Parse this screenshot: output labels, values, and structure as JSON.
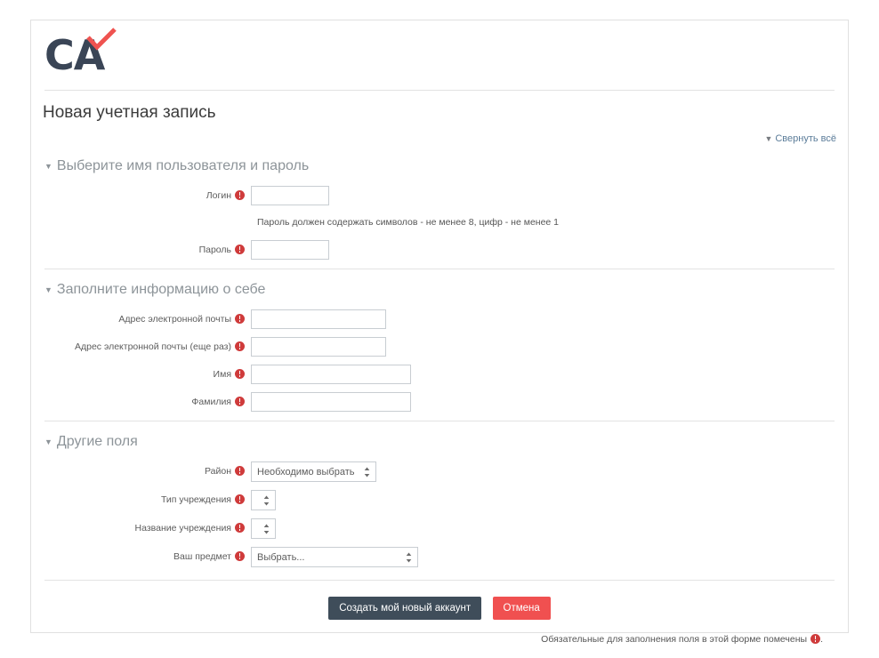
{
  "brand": {
    "logo_text": "CA",
    "logo_check_color": "#ef5350",
    "logo_text_color": "#3a4556"
  },
  "page": {
    "title": "Новая учетная запись"
  },
  "collapse_all": {
    "label": "Свернуть всё",
    "triangle": "▼"
  },
  "sections": [
    {
      "id": "credentials",
      "header": "Выберите имя пользователя и пароль",
      "triangle": "▼"
    },
    {
      "id": "about-you",
      "header": "Заполните информацию о себе",
      "triangle": "▼"
    },
    {
      "id": "other-fields",
      "header": "Другие поля",
      "triangle": "▼"
    }
  ],
  "fields": {
    "username": {
      "label": "Логин",
      "value": "",
      "required": true
    },
    "password": {
      "label": "Пароль",
      "value": "",
      "required": true
    },
    "password_hint": "Пароль должен содержать символов - не менее 8, цифр - не менее 1",
    "email": {
      "label": "Адрес электронной почты",
      "value": "",
      "required": true
    },
    "email_again": {
      "label": "Адрес электронной почты (еще раз)",
      "value": "",
      "required": true
    },
    "firstname": {
      "label": "Имя",
      "value": "",
      "required": true
    },
    "lastname": {
      "label": "Фамилия",
      "value": "",
      "required": true
    },
    "region": {
      "label": "Район",
      "selected": "Необходимо выбрать",
      "required": true
    },
    "institution_type": {
      "label": "Тип учреждения",
      "selected": "",
      "required": true
    },
    "institution_name": {
      "label": "Название учреждения",
      "selected": "",
      "required": true
    },
    "subject": {
      "label": "Ваш предмет",
      "selected": "Выбрать...",
      "required": true
    }
  },
  "buttons": {
    "submit": "Создать мой новый аккаунт",
    "cancel": "Отмена"
  },
  "footer": {
    "note_before": "Обязательные для заполнения поля в этой форме помечены",
    "note_after": "."
  },
  "colors": {
    "required_marker": "#cf3b3b",
    "primary_button": "#3f4d5a",
    "cancel_button": "#f05050",
    "section_header": "#8d9499",
    "border": "#c8cdd2"
  }
}
